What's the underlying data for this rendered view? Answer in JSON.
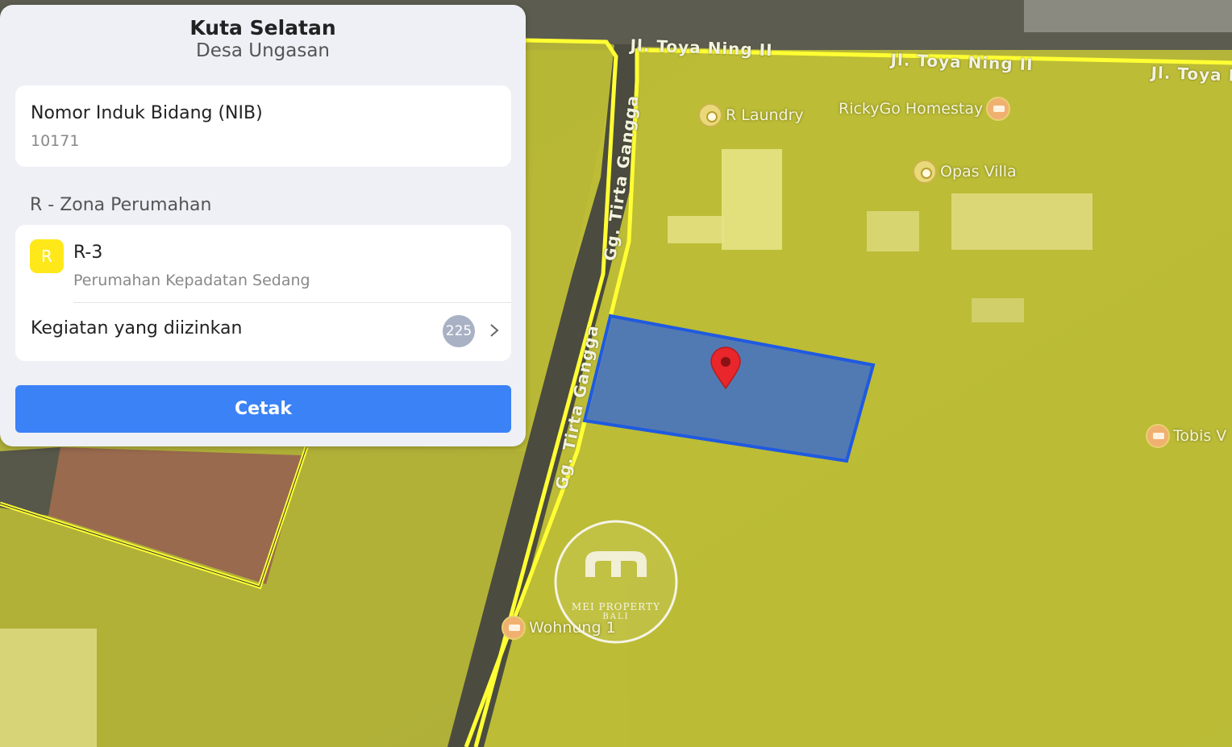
{
  "panel": {
    "title": "Kuta Selatan",
    "subtitle": "Desa Ungasan",
    "nib": {
      "label": "Nomor Induk Bidang (NIB)",
      "value": "10171"
    },
    "zone": {
      "heading": "R - Zona Perumahan",
      "badge": "R",
      "code": "R-3",
      "description": "Perumahan Kepadatan Sedang",
      "activities_label": "Kegiatan yang diizinkan",
      "activities_count": "225"
    },
    "print_label": "Cetak"
  },
  "map": {
    "streets": {
      "toya_a": "Jl. Toya Ning II",
      "toya_b": "Jl. Toya Ning II",
      "toya_c": "Jl. Toya N",
      "tirta_a": "Gg. Tirta Gangga",
      "tirta_b": "Gg. Tirta Gangga"
    },
    "pois": {
      "laundry": "R Laundry",
      "homestay": "RickyGo Homestay",
      "opas": "Opas Villa",
      "tobis": "Tobis V",
      "wohnung": "Wohnung 1"
    },
    "watermark": {
      "name": "MEI PROPERTY",
      "sub": "BALI",
      "monogram": "m"
    },
    "colors": {
      "zone_fill": "#d9d93a",
      "boundary": "#ffff33",
      "parcel": "#3f6fc8",
      "marker": "#e8262b"
    }
  }
}
